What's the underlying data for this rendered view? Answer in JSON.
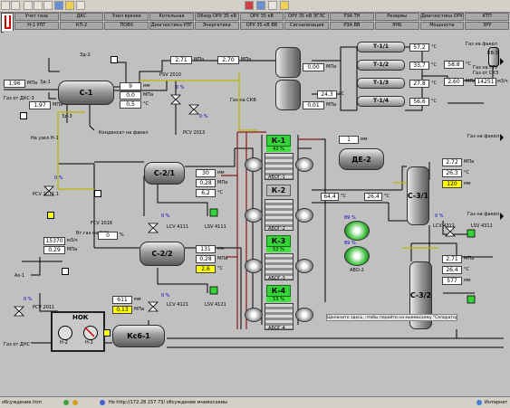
{
  "logo": "ЛУК",
  "nav_row1": [
    "Учет газа",
    "ДКС",
    "Узел врезки",
    "Котельная",
    "Обзор ОРУ 35 кВ",
    "ОРУ 35 кВ",
    "ОРУ 35 кВ ЭГЭС",
    "РЗА ТН",
    "Резервы",
    "Диагностика ОРУ",
    "КТП"
  ],
  "nav_row2": [
    "Н-1 УПГ",
    "КП-2",
    "ПОВХ",
    "Диагностика УПГ",
    "Энергетика",
    "ОРУ 35 кВ ВВ",
    "Сигнализация",
    "РЗА ВВ",
    "ЭНБ",
    "Мощности",
    "ЗРУ"
  ],
  "tags": {
    "zd1": "Зд-1",
    "zd2": "Зд-2",
    "zd3": "Зд-3",
    "c1": "С-1",
    "c21": "С-2/1",
    "c22": "С-2/2",
    "c31": "С-3/1",
    "c32": "С-3/2",
    "kc61": "Кс6-1",
    "de2": "ДЕ-2",
    "avo2": "АВО-2",
    "psv2010": "PSV 2010",
    "pcv2013": "PCV 2013",
    "pcv20111": "PCV 2011.1",
    "pcv2011": "PCV 2011",
    "fcv2016": "FCV 2016",
    "lcv4111": "LCV 4111",
    "lsv4111": "LSV 4111",
    "lcv4121": "LCV 4121",
    "lsv4121": "LSV 4121",
    "lcv4311": "LCV 4311",
    "lsv4311": "LSV 4311",
    "az1": "Аз-1",
    "kv3": "КВ-3",
    "t11": "Т-1/1",
    "t12": "Т-1/2",
    "t13": "Т-1/3",
    "t14": "Т-1/4",
    "nok": "НОК",
    "n2": "Н-2",
    "n1": "Н-1"
  },
  "compressors": [
    {
      "name": "К-1",
      "pct": "42 %",
      "avo": "АВОГ-1",
      "active": true
    },
    {
      "name": "К-2",
      "pct": "",
      "avo": "АВОГ-2",
      "active": false
    },
    {
      "name": "К-3",
      "pct": "52 %",
      "avo": "АВОГ-3",
      "active": true
    },
    {
      "name": "К-4",
      "pct": "53 %",
      "avo": "АВОГ-4",
      "active": true
    }
  ],
  "notes": {
    "gas_to_flare1": "Газ на факел",
    "gas_to_flare2": "Газ на факел",
    "gas_to_flare3": "Газ на факел",
    "gas_to_skv": "Газ на СКВ",
    "gas_from_dks": "Газ от ДКС-3",
    "gas_from_skz": "Газ от СКЗ",
    "gas_to_gtu": "Газ на ГТУ",
    "condensate": "Конденсат на факел",
    "tail": "Газ от ДНС",
    "separator_hint": "Щелкните здесь, чтобы перейти на мнемосхему \"Сепараторы С-3/1, С-3/2\"",
    "to_vkn": "Вт.газ на ВКН",
    "to_h1": "На узел Н-1"
  },
  "values": {
    "zd1_p1": "1,96",
    "zd1_u1": "МПа",
    "zd1_p2": "1,97",
    "zd1_u2": "МПа",
    "c1_l1": "9",
    "c1_l1u": "мм",
    "c1_l2": "0,0",
    "c1_l2u": "МПа",
    "c1_l3": "0,5",
    "c1_l3u": "°C",
    "psv_p": "2,71",
    "psv_u": "МПа",
    "c3_p": "2,70",
    "c3_u": "МПа",
    "v1_p": "0,00",
    "v1_u": "МПа",
    "v2_p": "24,3",
    "v2_u": "°C",
    "v3_p": "0,01",
    "v3_u": "МПа",
    "t11": "57,2",
    "t12": "33,7",
    "t13": "27,8",
    "t14": "56,6",
    "tu": "°C",
    "kv3_t": "58,8",
    "kv3_tu": "°C",
    "kv3_p": "2,60",
    "kv3_pu": "МПа",
    "kv3_q": "14251",
    "kv3_qu": "м3/ч",
    "c21_1": "30",
    "c21_1u": "мм",
    "c21_2": "0,28",
    "c21_2u": "МПа",
    "c21_3": "6,2",
    "c21_3u": "°C",
    "c22_1": "131",
    "c22_1u": "мм",
    "c22_2": "0,28",
    "c22_2u": "МПа",
    "c22_3": "2,6",
    "c22_3u": "°C",
    "fcv": "0",
    "fcv_u": "%",
    "az_q": "15370",
    "az_qu": "м3/ч",
    "az_p": "0,29",
    "az_pu": "МПа",
    "kc_1": "611",
    "kc_1u": "мм",
    "kc_2": "0,13",
    "kc_2u": "МПа",
    "de2_v": "1",
    "de2_u": "мм",
    "mid1": "64,4",
    "mid1u": "°C",
    "mid2": "26,4",
    "mid2u": "°C",
    "avo2_pct": "89 %",
    "c31_1": "2,72",
    "c31_1u": "МПа",
    "c31_2": "26,3",
    "c31_2u": "°C",
    "c31_3": "120",
    "c31_3u": "мм",
    "c32_1": "2,71",
    "c32_1u": "МПа",
    "c32_2": "26,4",
    "c32_2u": "°C",
    "c32_3": "577",
    "c32_3u": "мм",
    "pct_psv": "0 %",
    "pct_pcv2013": "0 %",
    "pct_pcv20111": "0 %",
    "pct_pcv2011": "0 %",
    "pct_lcv4111": "0 %",
    "pct_lcv4121": "0 %",
    "pct_lcv4311": "0 %"
  },
  "taskbar": {
    "left": "обсуждение.htm",
    "middle": "Не http://172.28.157.73/ обсуждение мнемосхемы",
    "right": "Интернет"
  },
  "colors": {
    "pipe_gas": "#000000",
    "pipe_hot": "#8b1a1a",
    "pipe_cond": "#b8b800",
    "active": "#36d23a"
  }
}
